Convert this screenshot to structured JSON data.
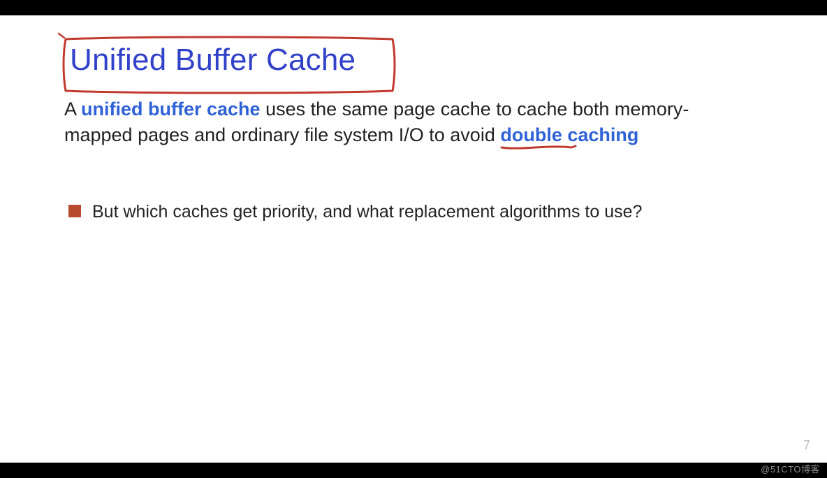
{
  "slide": {
    "title": "Unified Buffer Cache",
    "body_pre": "A ",
    "body_kw1": "unified buffer cache",
    "body_mid": " uses the same page cache to cache both memory-mapped pages and ordinary file system I/O to avoid ",
    "body_kw2": "double caching",
    "bullet1": "But which caches get priority, and what replacement algorithms to use?",
    "page_number": "7",
    "watermark": "@51CTO博客",
    "annotation_color": "#c23a2e"
  }
}
